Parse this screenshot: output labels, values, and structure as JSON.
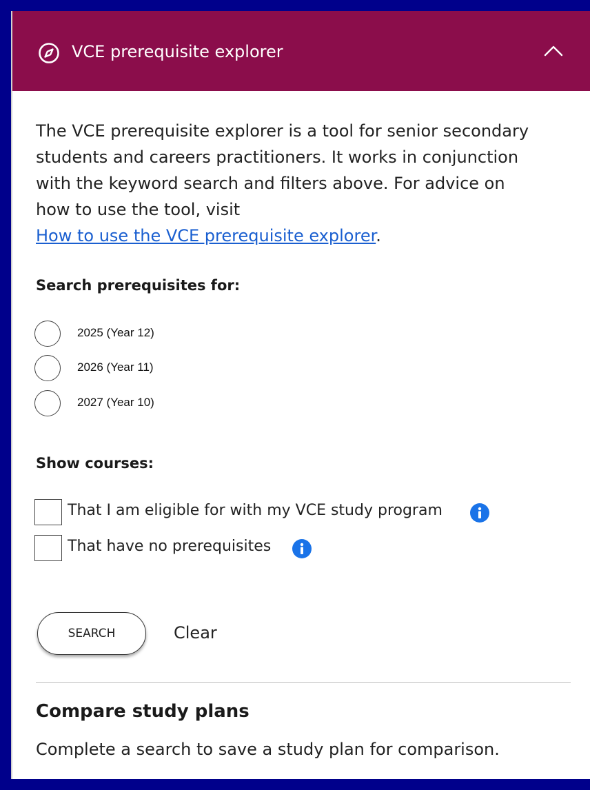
{
  "header": {
    "title": "VCE prerequisite explorer",
    "icon": "compass-icon",
    "toggle_icon": "chevron-up-icon",
    "color": "#8b0d4b"
  },
  "intro": {
    "lines": [
      "The VCE prerequisite explorer is a tool for senior secondary",
      "students and careers practitioners. It works in conjunction",
      "with the keyword search and filters above. For advice on",
      "how to use the tool, visit"
    ],
    "link_text": "How to use the VCE prerequisite explorer",
    "link_suffix": "."
  },
  "search_for": {
    "heading": "Search prerequisites for:",
    "options": [
      {
        "label": "2025 (Year 12)"
      },
      {
        "label": "2026 (Year 11)"
      },
      {
        "label": "2027 (Year 10)"
      }
    ]
  },
  "show_courses": {
    "heading": "Show courses:",
    "options": [
      {
        "label": "That I am eligible for with my VCE study program",
        "icon": "info-icon"
      },
      {
        "label": "That have no prerequisites",
        "icon": "info-icon"
      }
    ]
  },
  "actions": {
    "search_label": "SEARCH",
    "clear_label": "Clear"
  },
  "compare": {
    "heading": "Compare study plans",
    "text": "Complete a search to save a study plan for comparison."
  },
  "colors": {
    "page_background": "#00008b",
    "link": "#1a5fd0",
    "info": "#1a73e8"
  }
}
